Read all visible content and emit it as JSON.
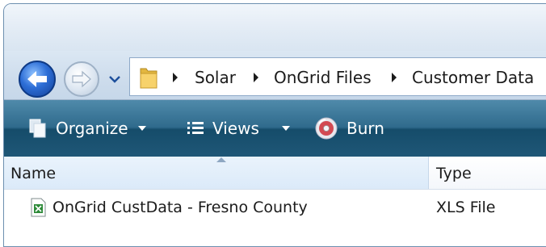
{
  "breadcrumb": {
    "items": [
      "Solar",
      "OnGrid Files",
      "Customer Data"
    ]
  },
  "toolbar": {
    "organize_label": "Organize",
    "views_label": "Views",
    "burn_label": "Burn"
  },
  "columns": {
    "name_label": "Name",
    "type_label": "Type"
  },
  "files": [
    {
      "name": "OnGrid CustData - Fresno County",
      "type": "XLS File",
      "icon": "excel-file-icon"
    }
  ],
  "colors": {
    "toolbar": "#2f6a8c",
    "address_bar": "#cddcec",
    "header_highlight": "#dbeaf9"
  },
  "icons": {
    "back": "back-arrow-icon",
    "forward": "forward-arrow-icon",
    "recent": "chevron-down-icon",
    "folder": "folder-icon",
    "organize": "organize-icon",
    "views": "views-icon",
    "burn": "burn-disc-icon"
  }
}
